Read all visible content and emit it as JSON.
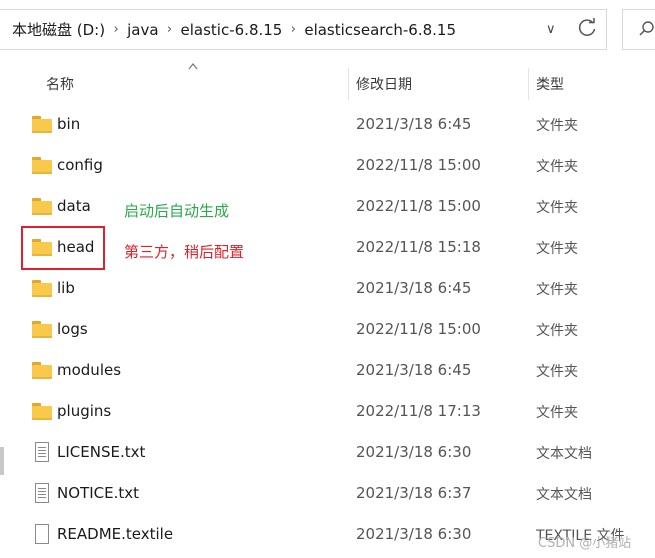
{
  "address_bar": {
    "segments": [
      "本地磁盘 (D:)",
      "java",
      "elastic-6.8.15",
      "elasticsearch-6.8.15"
    ]
  },
  "columns": {
    "name": "名称",
    "date_modified": "修改日期",
    "type": "类型"
  },
  "files": [
    {
      "name": "bin",
      "date": "2021/3/18 6:45",
      "type": "文件夹",
      "icon": "folder-icon"
    },
    {
      "name": "config",
      "date": "2022/11/8 15:00",
      "type": "文件夹",
      "icon": "folder-icon"
    },
    {
      "name": "data",
      "date": "2022/11/8 15:00",
      "type": "文件夹",
      "icon": "folder-icon"
    },
    {
      "name": "head",
      "date": "2022/11/8 15:18",
      "type": "文件夹",
      "icon": "folder-icon"
    },
    {
      "name": "lib",
      "date": "2021/3/18 6:45",
      "type": "文件夹",
      "icon": "folder-icon"
    },
    {
      "name": "logs",
      "date": "2022/11/8 15:00",
      "type": "文件夹",
      "icon": "folder-icon"
    },
    {
      "name": "modules",
      "date": "2021/3/18 6:45",
      "type": "文件夹",
      "icon": "folder-icon"
    },
    {
      "name": "plugins",
      "date": "2022/11/8 17:13",
      "type": "文件夹",
      "icon": "folder-icon"
    },
    {
      "name": "LICENSE.txt",
      "date": "2021/3/18 6:30",
      "type": "文本文档",
      "icon": "text-file-icon"
    },
    {
      "name": "NOTICE.txt",
      "date": "2021/3/18 6:37",
      "type": "文本文档",
      "icon": "text-file-icon"
    },
    {
      "name": "README.textile",
      "date": "2021/3/18 6:30",
      "type": "TEXTILE 文件",
      "icon": "file-icon"
    }
  ],
  "annotations": {
    "data_note": "启动后自动生成",
    "head_note": "第三方，稍后配置"
  },
  "watermark": "CSDN @小猪站",
  "colors": {
    "folder": "#f8c94b",
    "note_green": "#2aa84a",
    "note_red": "#e0202a"
  }
}
